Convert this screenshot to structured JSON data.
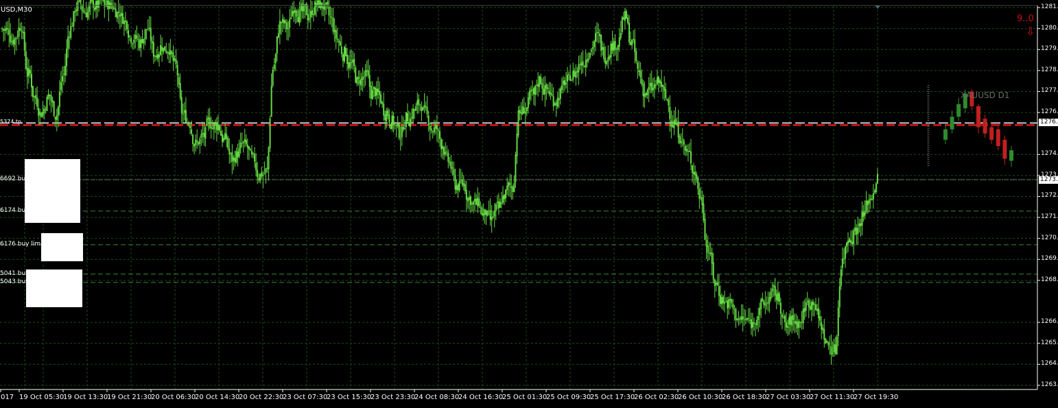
{
  "window": {
    "symbol_title": "USD,M30"
  },
  "price_axis": {
    "labels": [
      "1281.",
      "1280.",
      "1279.",
      "1278.",
      "1277.",
      "1276.",
      "1274.",
      "1273.",
      "1272.",
      "1271.",
      "1270.",
      "1269.",
      "1268.",
      "1266.",
      "1265.",
      "1264.",
      "1263."
    ],
    "current_price_tag": "1276.",
    "bid_tag": "1273."
  },
  "time_axis": {
    "labels": [
      "017",
      "19 Oct 05:30",
      "19 Oct 13:30",
      "19 Oct 21:30",
      "20 Oct 06:30",
      "20 Oct 14:30",
      "20 Oct 22:30",
      "23 Oct 07:30",
      "23 Oct 15:30",
      "23 Oct 23:30",
      "24 Oct 08:30",
      "24 Oct 16:30",
      "25 Oct 01:30",
      "25 Oct 09:30",
      "25 Oct 17:30",
      "26 Oct 02:30",
      "26 Oct 10:30",
      "26 Oct 18:30",
      "27 Oct 03:30",
      "27 Oct 11:30",
      "27 Oct 19:30"
    ]
  },
  "orders": [
    {
      "label": "6692 buy",
      "price": 1273.3
    },
    {
      "label": "6174 buy",
      "price": 1271.8
    },
    {
      "label": "6176 buy limit",
      "price": 1270.2
    },
    {
      "label": "5041 buy",
      "price": 1268.8
    },
    {
      "label": "5043 buy",
      "price": 1268.4
    }
  ],
  "stop_line_label": "5374 tp",
  "mini_chart": {
    "label": "XAUUSD D1"
  },
  "signal": {
    "text": "9..0",
    "arrow": "⇩"
  },
  "colors": {
    "background": "#000000",
    "candle": "#66dd44",
    "grid": "#1e4a1e",
    "order_line": "#3a8a3a",
    "stop_line": "#e01818",
    "ask_line": "#ffffff",
    "mini_bull": "#2e8b2e",
    "mini_bear": "#c02020"
  },
  "chart_data": {
    "type": "candlestick",
    "symbol": "USD,M30",
    "ylim": [
      1263.3,
      1281.6
    ],
    "ask_price": 1276.0,
    "stop_price": 1275.9,
    "bid_price": 1273.3,
    "closes": [
      1280.4,
      1280.0,
      1280.7,
      1278.3,
      1277.2,
      1276.5,
      1277.3,
      1276.4,
      1278.3,
      1280.5,
      1281.6,
      1281.3,
      1281.6,
      1281.6,
      1281.6,
      1281.6,
      1281.3,
      1280.8,
      1280.1,
      1279.8,
      1280.5,
      1279.3,
      1279.7,
      1279.6,
      1278.7,
      1276.4,
      1276.0,
      1275.0,
      1275.4,
      1276.0,
      1275.9,
      1275.2,
      1274.3,
      1274.6,
      1274.9,
      1274.2,
      1273.5,
      1273.7,
      1278.8,
      1280.8,
      1280.5,
      1281.6,
      1281.3,
      1281.1,
      1281.6,
      1281.6,
      1281.0,
      1280.0,
      1279.3,
      1278.8,
      1277.9,
      1278.2,
      1277.4,
      1277.3,
      1276.5,
      1276.1,
      1275.5,
      1276.3,
      1276.6,
      1276.9,
      1276.2,
      1275.7,
      1275.0,
      1274.1,
      1273.0,
      1273.1,
      1272.4,
      1272.1,
      1271.6,
      1271.3,
      1271.9,
      1272.6,
      1272.9,
      1276.5,
      1276.7,
      1277.3,
      1278.1,
      1277.6,
      1277.1,
      1277.5,
      1278.0,
      1278.4,
      1279.0,
      1279.5,
      1280.1,
      1279.4,
      1279.6,
      1279.8,
      1281.0,
      1279.8,
      1278.4,
      1277.4,
      1277.6,
      1277.9,
      1277.1,
      1276.0,
      1275.4,
      1274.5,
      1273.7,
      1272.3,
      1269.9,
      1268.3,
      1267.6,
      1267.4,
      1266.8,
      1266.6,
      1266.5,
      1266.9,
      1267.4,
      1267.8,
      1267.6,
      1266.3,
      1266.6,
      1266.5,
      1267.4,
      1267.6,
      1266.4,
      1265.4,
      1265.2,
      1269.4,
      1270.6,
      1271.0,
      1271.6,
      1272.4,
      1273.3
    ],
    "xlabels": [
      "017",
      "19 Oct 05:30",
      "19 Oct 13:30",
      "19 Oct 21:30",
      "20 Oct 06:30",
      "20 Oct 14:30",
      "20 Oct 22:30",
      "23 Oct 07:30",
      "23 Oct 15:30",
      "23 Oct 23:30",
      "24 Oct 08:30",
      "24 Oct 16:30",
      "25 Oct 01:30",
      "25 Oct 09:30",
      "25 Oct 17:30",
      "26 Oct 02:30",
      "26 Oct 10:30",
      "26 Oct 18:30",
      "27 Oct 03:30",
      "27 Oct 11:30",
      "27 Oct 19:30"
    ]
  },
  "mini_candles": [
    {
      "o": 1275.2,
      "c": 1275.7,
      "h": 1275.9,
      "l": 1275.0
    },
    {
      "o": 1275.7,
      "c": 1276.3,
      "h": 1276.6,
      "l": 1275.5
    },
    {
      "o": 1276.3,
      "c": 1276.9,
      "h": 1277.2,
      "l": 1276.1
    },
    {
      "o": 1276.7,
      "c": 1277.4,
      "h": 1277.6,
      "l": 1276.5
    },
    {
      "o": 1277.5,
      "c": 1276.8,
      "h": 1277.6,
      "l": 1276.6
    },
    {
      "o": 1276.8,
      "c": 1275.8,
      "h": 1276.9,
      "l": 1275.5
    },
    {
      "o": 1276.2,
      "c": 1275.5,
      "h": 1276.4,
      "l": 1275.3
    },
    {
      "o": 1275.8,
      "c": 1275.2,
      "h": 1276.0,
      "l": 1275.0
    },
    {
      "o": 1275.7,
      "c": 1274.9,
      "h": 1275.9,
      "l": 1274.7
    },
    {
      "o": 1275.2,
      "c": 1274.3,
      "h": 1275.4,
      "l": 1274.0
    },
    {
      "o": 1274.2,
      "c": 1274.7,
      "h": 1274.9,
      "l": 1273.9
    }
  ]
}
